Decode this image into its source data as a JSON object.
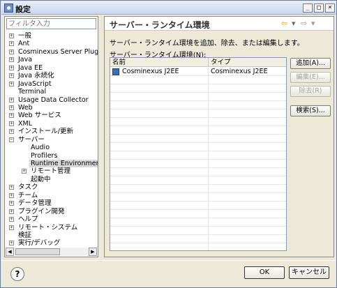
{
  "window": {
    "title": "設定",
    "minimize": "_",
    "maximize": "□",
    "close": "×"
  },
  "filter": {
    "placeholder": "フィルタ入力"
  },
  "tree": {
    "items": [
      {
        "label": "一般",
        "level": 0,
        "expander": "+"
      },
      {
        "label": "Ant",
        "level": 0,
        "expander": "+"
      },
      {
        "label": "Cosminexus Server Plug-in",
        "level": 0,
        "expander": "+"
      },
      {
        "label": "Java",
        "level": 0,
        "expander": "+"
      },
      {
        "label": "Java EE",
        "level": 0,
        "expander": "+"
      },
      {
        "label": "Java 永続化",
        "level": 0,
        "expander": "+"
      },
      {
        "label": "JavaScript",
        "level": 0,
        "expander": "+"
      },
      {
        "label": "Terminal",
        "level": 0,
        "expander": ""
      },
      {
        "label": "Usage Data Collector",
        "level": 0,
        "expander": "+"
      },
      {
        "label": "Web",
        "level": 0,
        "expander": "+"
      },
      {
        "label": "Web サービス",
        "level": 0,
        "expander": "+"
      },
      {
        "label": "XML",
        "level": 0,
        "expander": "+"
      },
      {
        "label": "インストール/更新",
        "level": 0,
        "expander": "+"
      },
      {
        "label": "サーバー",
        "level": 0,
        "expander": "−"
      },
      {
        "label": "Audio",
        "level": 1,
        "expander": ""
      },
      {
        "label": "Profilers",
        "level": 1,
        "expander": ""
      },
      {
        "label": "Runtime Environments",
        "level": 1,
        "expander": "",
        "selected": true
      },
      {
        "label": "リモート管理",
        "level": 1,
        "expander": "+"
      },
      {
        "label": "起動中",
        "level": 1,
        "expander": ""
      },
      {
        "label": "タスク",
        "level": 0,
        "expander": "+"
      },
      {
        "label": "チーム",
        "level": 0,
        "expander": "+"
      },
      {
        "label": "データ管理",
        "level": 0,
        "expander": "+"
      },
      {
        "label": "プラグイン開発",
        "level": 0,
        "expander": "+"
      },
      {
        "label": "ヘルプ",
        "level": 0,
        "expander": "+"
      },
      {
        "label": "リモート・システム",
        "level": 0,
        "expander": "+"
      },
      {
        "label": "検証",
        "level": 0,
        "expander": ""
      },
      {
        "label": "実行/デバッグ",
        "level": 0,
        "expander": "+"
      }
    ]
  },
  "main": {
    "title": "サーバー・ランタイム環境",
    "description": "サーバー・ランタイム環境を追加、除去、または編集します。",
    "env_label": "サーバー・ランタイム環境(N):",
    "nav": {
      "back": "⇦",
      "back_menu": "▾",
      "forward": "⇨",
      "forward_menu": "▾"
    },
    "table": {
      "columns": [
        "名前",
        "タイプ"
      ],
      "rows": [
        {
          "name": "Cosminexus J2EE",
          "type": "Cosminexus J2EE"
        }
      ]
    },
    "buttons": {
      "add": "追加(A)...",
      "edit": "編集(E)...",
      "remove": "除去(R)",
      "search": "検索(S)..."
    }
  },
  "dialog": {
    "help": "?",
    "ok": "OK",
    "cancel": "キャンセル"
  }
}
